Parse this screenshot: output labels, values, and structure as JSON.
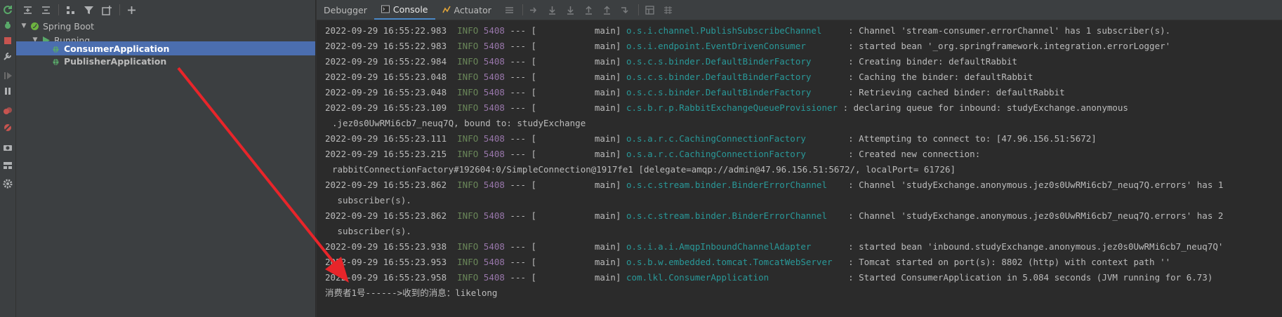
{
  "tree": {
    "root_label": "Spring Boot",
    "running_label": "Running",
    "apps": [
      {
        "label": "ConsumerApplication",
        "selected": true
      },
      {
        "label": "PublisherApplication",
        "selected": false
      }
    ]
  },
  "console": {
    "tabs": {
      "debugger": "Debugger",
      "console": "Console",
      "actuator": "Actuator"
    },
    "lines": [
      {
        "ts": "2022-09-29 16:55:22.983",
        "lvl": "INFO",
        "pid": "5408",
        "sep": " --- [           main] ",
        "logger": "o.s.i.channel.PublishSubscribeChannel    ",
        "msg": " : Channel 'stream-consumer.errorChannel' has 1 subscriber(s)."
      },
      {
        "ts": "2022-09-29 16:55:22.983",
        "lvl": "INFO",
        "pid": "5408",
        "sep": " --- [           main] ",
        "logger": "o.s.i.endpoint.EventDrivenConsumer       ",
        "msg": " : started bean '_org.springframework.integration.errorLogger'"
      },
      {
        "ts": "2022-09-29 16:55:22.984",
        "lvl": "INFO",
        "pid": "5408",
        "sep": " --- [           main] ",
        "logger": "o.s.c.s.binder.DefaultBinderFactory      ",
        "msg": " : Creating binder: defaultRabbit"
      },
      {
        "ts": "2022-09-29 16:55:23.048",
        "lvl": "INFO",
        "pid": "5408",
        "sep": " --- [           main] ",
        "logger": "o.s.c.s.binder.DefaultBinderFactory      ",
        "msg": " : Caching the binder: defaultRabbit"
      },
      {
        "ts": "2022-09-29 16:55:23.048",
        "lvl": "INFO",
        "pid": "5408",
        "sep": " --- [           main] ",
        "logger": "o.s.c.s.binder.DefaultBinderFactory      ",
        "msg": " : Retrieving cached binder: defaultRabbit"
      },
      {
        "ts": "2022-09-29 16:55:23.109",
        "lvl": "INFO",
        "pid": "5408",
        "sep": " --- [           main] ",
        "logger": "c.s.b.r.p.RabbitExchangeQueueProvisioner ",
        "msg": ": declaring queue for inbound: studyExchange.anonymous"
      },
      {
        "cont": ".jez0s0UwRMi6cb7_neuq7Q, bound to: studyExchange"
      },
      {
        "ts": "2022-09-29 16:55:23.111",
        "lvl": "INFO",
        "pid": "5408",
        "sep": " --- [           main] ",
        "logger": "o.s.a.r.c.CachingConnectionFactory       ",
        "msg": " : Attempting to connect to: [47.96.156.51:5672]"
      },
      {
        "ts": "2022-09-29 16:55:23.215",
        "lvl": "INFO",
        "pid": "5408",
        "sep": " --- [           main] ",
        "logger": "o.s.a.r.c.CachingConnectionFactory       ",
        "msg": " : Created new connection:"
      },
      {
        "cont": "rabbitConnectionFactory#192604:0/SimpleConnection@1917fe1 [delegate=amqp://admin@47.96.156.51:5672/, localPort= 61726]"
      },
      {
        "ts": "2022-09-29 16:55:23.862",
        "lvl": "INFO",
        "pid": "5408",
        "sep": " --- [           main] ",
        "logger": "o.s.c.stream.binder.BinderErrorChannel   ",
        "msg": " : Channel 'studyExchange.anonymous.jez0s0UwRMi6cb7_neuq7Q.errors' has 1"
      },
      {
        "cont": " subscriber(s)."
      },
      {
        "ts": "2022-09-29 16:55:23.862",
        "lvl": "INFO",
        "pid": "5408",
        "sep": " --- [           main] ",
        "logger": "o.s.c.stream.binder.BinderErrorChannel   ",
        "msg": " : Channel 'studyExchange.anonymous.jez0s0UwRMi6cb7_neuq7Q.errors' has 2"
      },
      {
        "cont": " subscriber(s)."
      },
      {
        "ts": "2022-09-29 16:55:23.938",
        "lvl": "INFO",
        "pid": "5408",
        "sep": " --- [           main] ",
        "logger": "o.s.i.a.i.AmqpInboundChannelAdapter      ",
        "msg": " : started bean 'inbound.studyExchange.anonymous.jez0s0UwRMi6cb7_neuq7Q'"
      },
      {
        "ts": "2022-09-29 16:55:23.953",
        "lvl": "INFO",
        "pid": "5408",
        "sep": " --- [           main] ",
        "logger": "o.s.b.w.embedded.tomcat.TomcatWebServer  ",
        "msg": " : Tomcat started on port(s): 8802 (http) with context path ''"
      },
      {
        "ts": "2022-09-29 16:55:23.958",
        "lvl": "INFO",
        "pid": "5408",
        "sep": " --- [           main] ",
        "logger": "com.lkl.ConsumerApplication              ",
        "msg": " : Started ConsumerApplication in 5.084 seconds (JVM running for 6.73)"
      },
      {
        "plain": "消费者1号------>收到的消息：likelong"
      }
    ]
  },
  "colors": {
    "accent": "#4b6eaf",
    "arrow": "#e8252a",
    "info": "#6a8759",
    "pid": "#9876aa",
    "logger": "#299999"
  }
}
